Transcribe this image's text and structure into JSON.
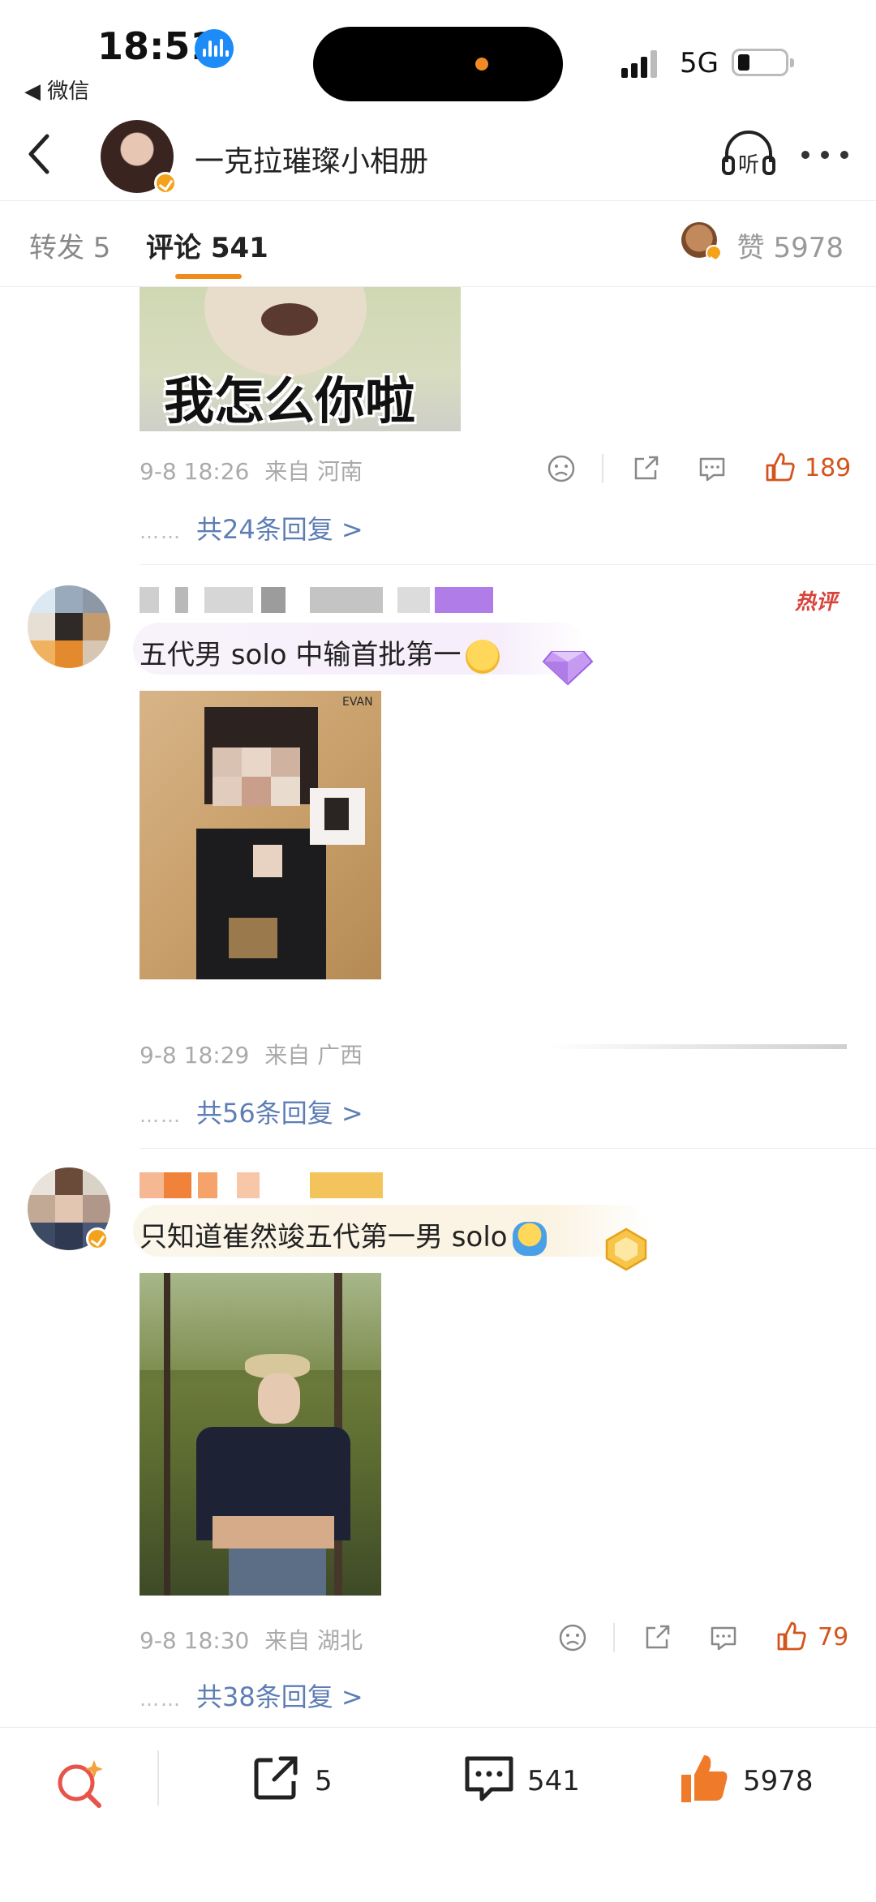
{
  "status_bar": {
    "time": "18:51",
    "back_app": "◀ 微信",
    "network": "5G"
  },
  "nav": {
    "title": "一克拉璀璨小相册",
    "back_icon": "chevron-left-icon",
    "listen_label": "听",
    "more_icon": "more-icon"
  },
  "tabs": {
    "repost": "转发 5",
    "comments": "评论 541",
    "likes": "赞 5978"
  },
  "colors": {
    "accent": "#f28a1a",
    "like": "#d4541e",
    "link": "#5d7eb5",
    "hot": "#d9433b"
  },
  "comments": [
    {
      "image_caption": "我怎么你啦",
      "time": "9-8 18:26",
      "location": "来自 河南",
      "likes": "189",
      "replies": "共24条回复 >"
    },
    {
      "text": "五代男 solo 中输首批第一",
      "hot_tag": "热评",
      "time": "9-8 18:29",
      "location": "来自 广西",
      "replies": "共56条回复 >",
      "photo_text_top": "EVAN"
    },
    {
      "text": "只知道崔然竣五代第一男 solo",
      "time": "9-8 18:30",
      "location": "来自 湖北",
      "likes": "79",
      "replies": "共38条回复 >"
    }
  ],
  "bottom_bar": {
    "search_icon": "sparkle-search-icon",
    "reposts": "5",
    "comments": "541",
    "likes": "5978"
  }
}
